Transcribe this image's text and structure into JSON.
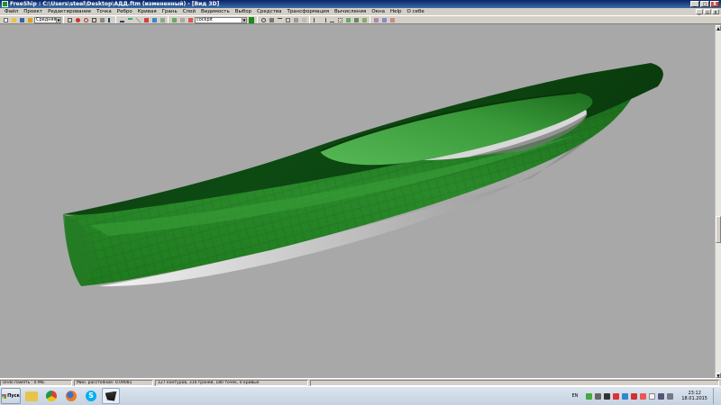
{
  "window": {
    "title": "FreeShip : C:\\Users\\steel\\Desktop\\АДД.ftm (измененный) - [Вид 3D]",
    "buttons": [
      "_",
      "□",
      "X"
    ]
  },
  "menubar": {
    "items": [
      "Файл",
      "Проект",
      "Редактирование",
      "Точка",
      "Ребро",
      "Кривая",
      "Грань",
      "Слой",
      "Видимость",
      "Выбор",
      "Средства",
      "Трансформация",
      "Вычисления",
      "Окна",
      "Help",
      "О себе"
    ],
    "mdi_buttons": [
      "_",
      "▫",
      "x"
    ]
  },
  "toolbar": {
    "precision_select": "Средняя",
    "layer_select": "cockpit",
    "layer_color": "#1a8a1a"
  },
  "statusbar": {
    "panels": [
      "Undo память : 0 Mb.",
      "Мин. расстояние: 0.09081",
      "127 контуров, 310 граней, 180 точек, 0 кривые"
    ]
  },
  "taskbar": {
    "start_label": "Пуск",
    "apps": [
      "explorer",
      "chrome",
      "firefox",
      "skype",
      "freeship"
    ],
    "lang": "EN",
    "time": "23:12",
    "date": "18.01.2015"
  },
  "colors": {
    "viewport_bg": "#a8a8a8",
    "hull_dark": "#0f3d0f",
    "hull_mid": "#1f7a1f",
    "hull_light": "#3fa63f"
  }
}
